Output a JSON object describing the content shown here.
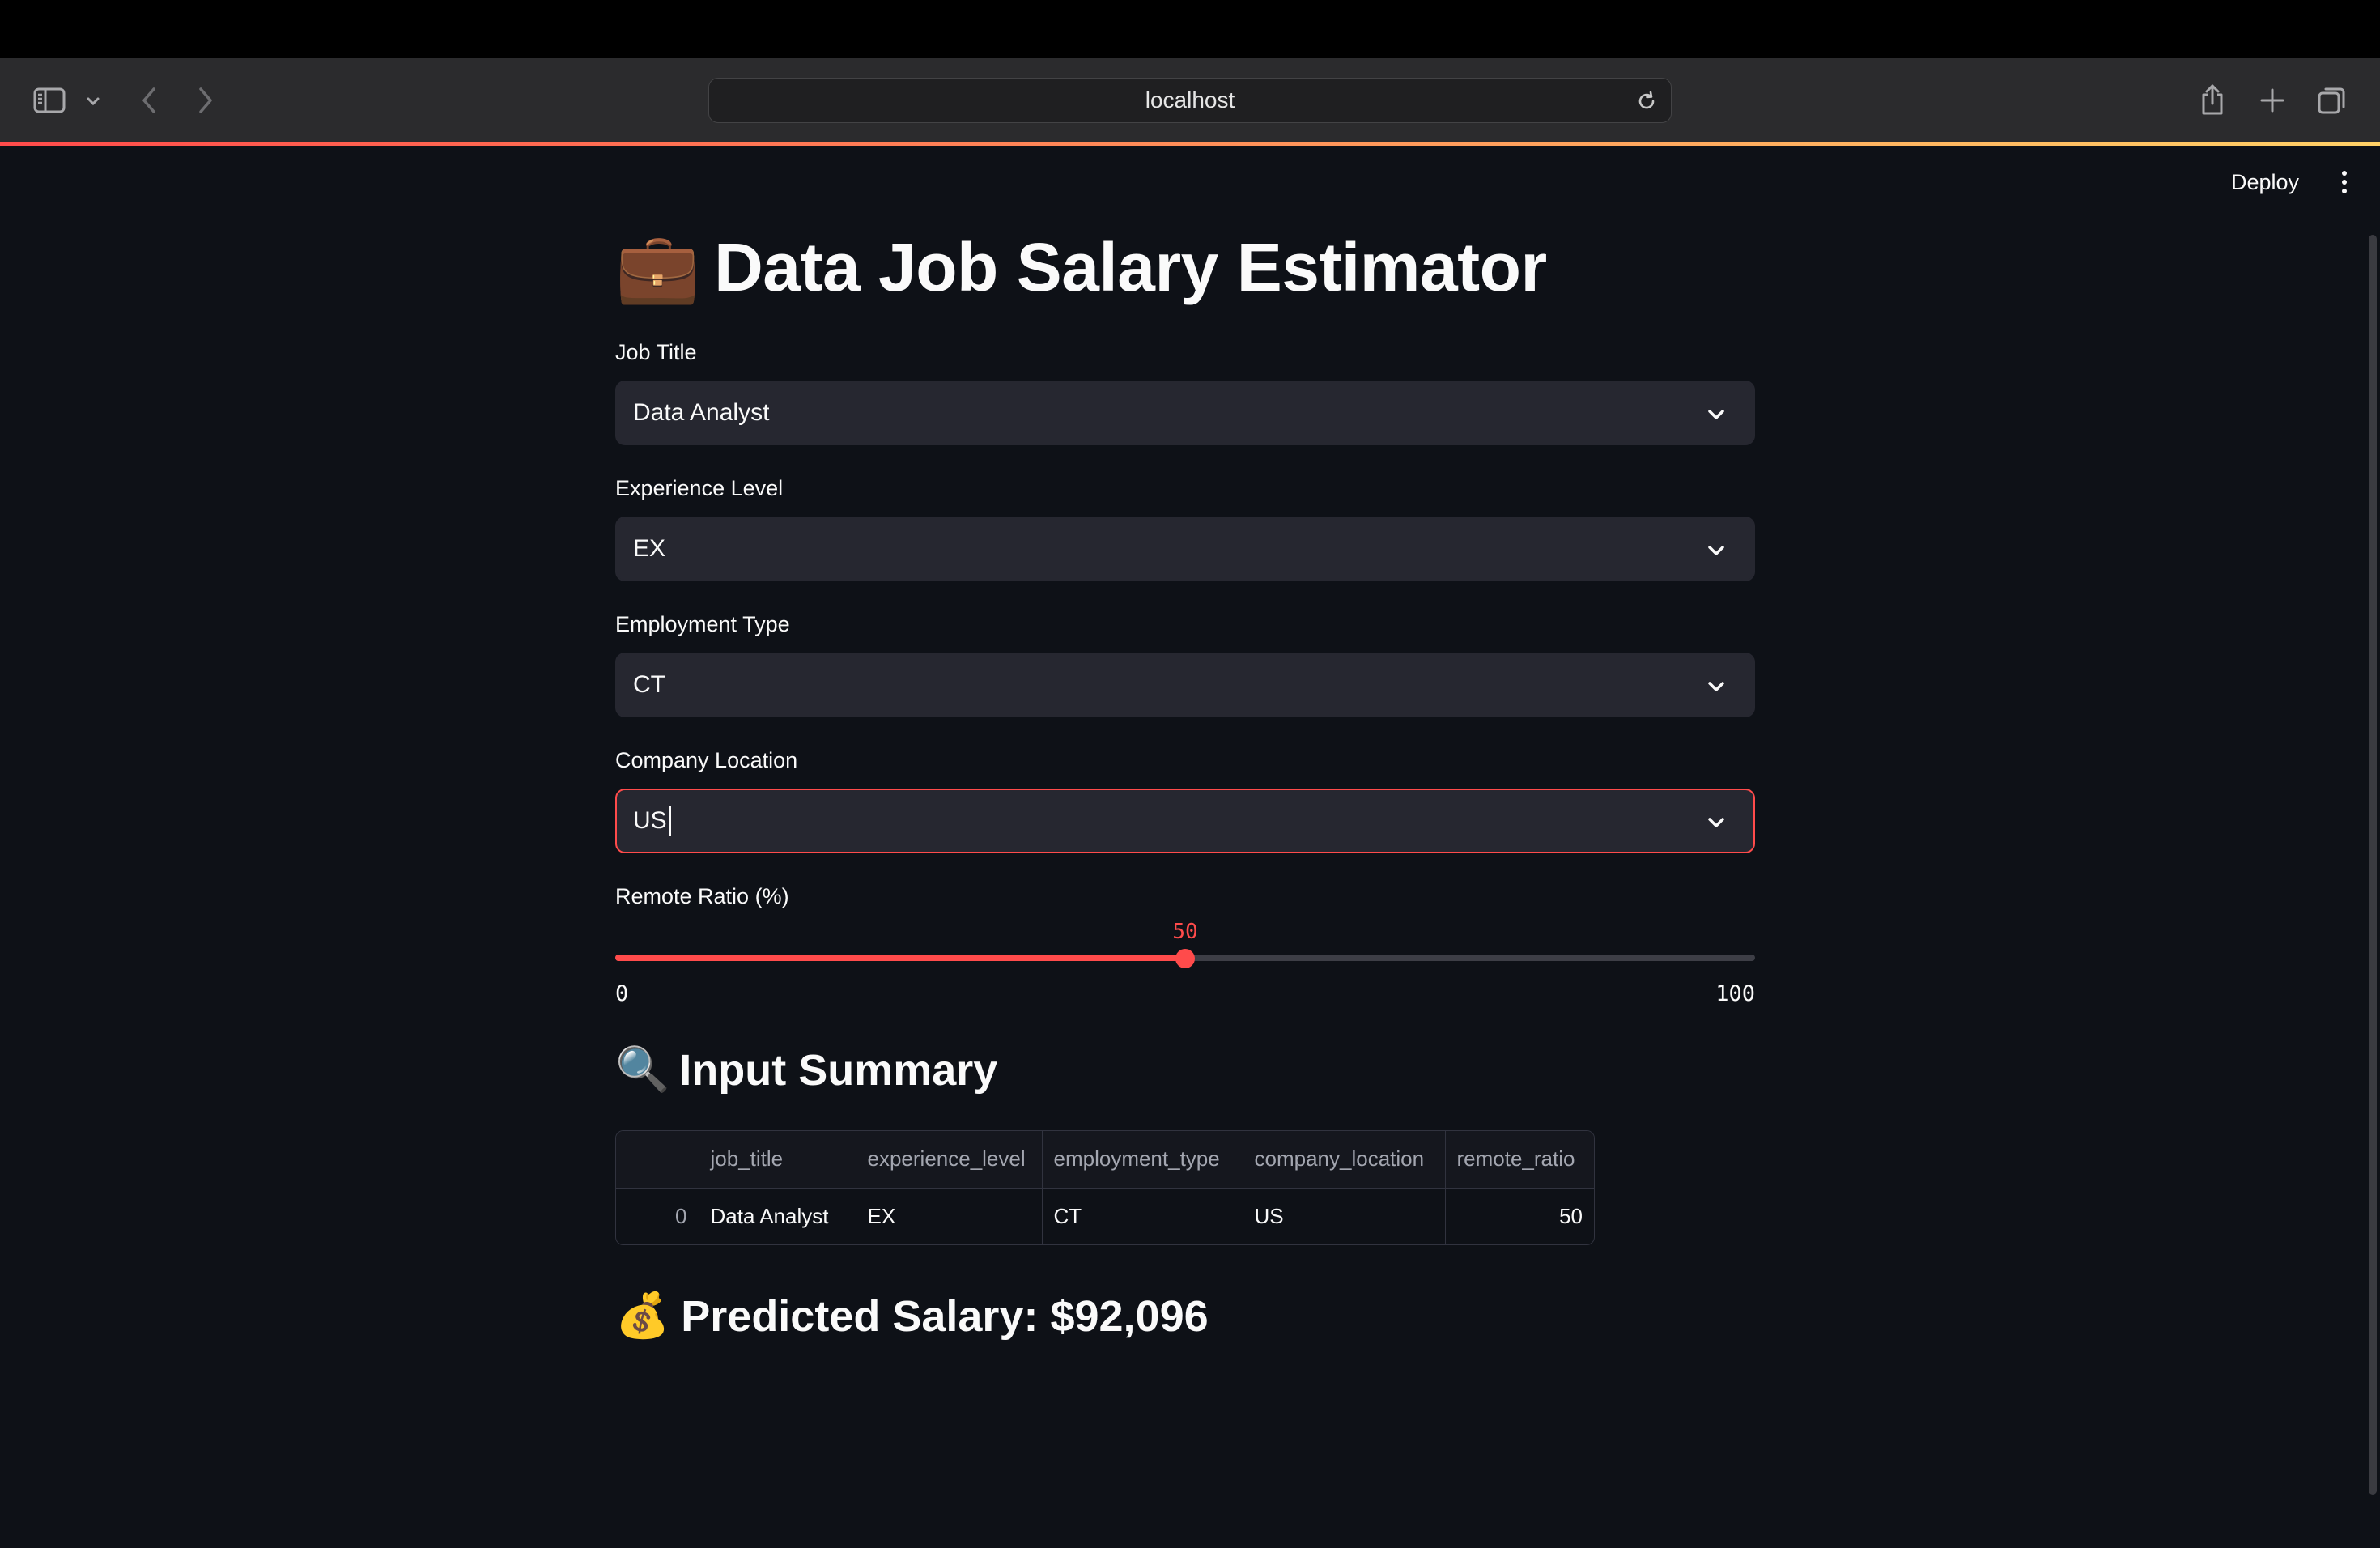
{
  "browser": {
    "url": "localhost"
  },
  "app_header": {
    "deploy_label": "Deploy"
  },
  "page": {
    "title_emoji": "💼",
    "title": "Data Job Salary Estimator"
  },
  "form": {
    "job_title": {
      "label": "Job Title",
      "value": "Data Analyst"
    },
    "experience_level": {
      "label": "Experience Level",
      "value": "EX"
    },
    "employment_type": {
      "label": "Employment Type",
      "value": "CT"
    },
    "company_location": {
      "label": "Company Location",
      "value": "US"
    },
    "remote_ratio": {
      "label": "Remote Ratio (%)",
      "value": 50,
      "value_text": "50",
      "min": "0",
      "max": "100",
      "fraction": 0.5
    }
  },
  "summary": {
    "emoji": "🔍",
    "heading": "Input Summary",
    "columns": [
      "",
      "job_title",
      "experience_level",
      "employment_type",
      "company_location",
      "remote_ratio"
    ],
    "rows": [
      [
        "0",
        "Data Analyst",
        "EX",
        "CT",
        "US",
        "50"
      ]
    ]
  },
  "prediction": {
    "emoji": "💰",
    "text": "Predicted Salary: $92,096"
  },
  "colors": {
    "background": "#0e1117",
    "input_bg": "#262730",
    "accent": "#ff4b4b"
  }
}
